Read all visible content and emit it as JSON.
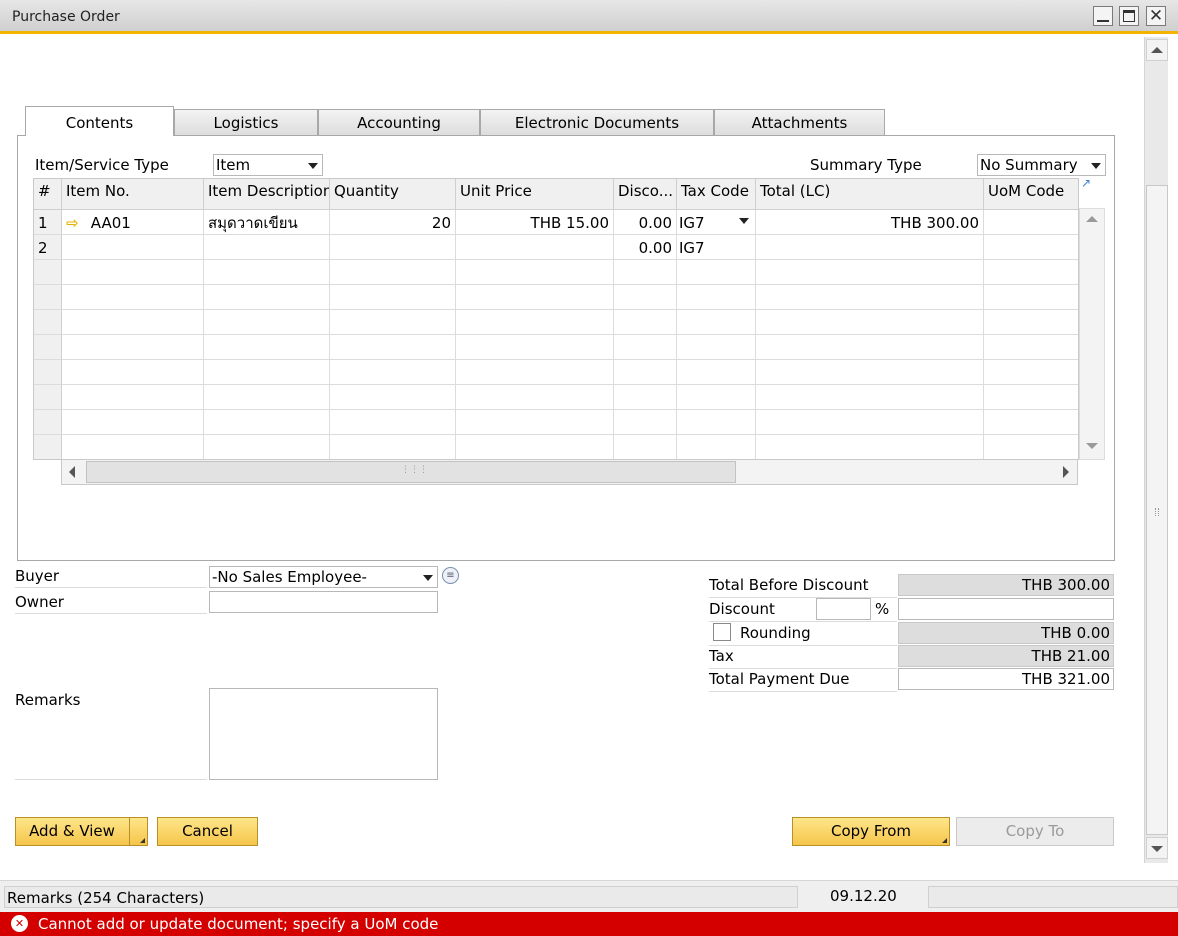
{
  "window": {
    "title": "Purchase Order",
    "min_glyph": "",
    "max_glyph": "",
    "close_glyph": "✕"
  },
  "tabs": [
    {
      "label": "Contents",
      "active": true
    },
    {
      "label": "Logistics"
    },
    {
      "label": "Accounting"
    },
    {
      "label": "Electronic Documents"
    },
    {
      "label": "Attachments"
    }
  ],
  "contents": {
    "item_service_type_label": "Item/Service Type",
    "item_service_type_value": "Item",
    "summary_type_label": "Summary Type",
    "summary_type_value": "No Summary"
  },
  "grid": {
    "columns": [
      "#",
      "Item No.",
      "Item Description",
      "Quantity",
      "Unit Price",
      "Disco...",
      "Tax Code",
      "Total (LC)",
      "UoM Code"
    ],
    "rows": [
      {
        "num": "1",
        "item_no": "AA01",
        "description": "สมุดวาดเขียน",
        "quantity": "20",
        "unit_price": "THB 15.00",
        "discount": "0.00",
        "tax_code": "IG7",
        "total": "THB 300.00",
        "uom": ""
      },
      {
        "num": "2",
        "item_no": "",
        "description": "",
        "quantity": "",
        "unit_price": "",
        "discount": "0.00",
        "tax_code": "IG7",
        "total": "",
        "uom": ""
      }
    ],
    "hscroll_grip": "⋮⋮⋮"
  },
  "buyer": {
    "label": "Buyer",
    "value": "-No Sales Employee-",
    "owner_label": "Owner",
    "owner_value": "",
    "remarks_label": "Remarks",
    "remarks_value": ""
  },
  "totals": {
    "total_before_discount_label": "Total Before Discount",
    "total_before_discount": "THB 300.00",
    "discount_label": "Discount",
    "discount_percent": "",
    "percent_sign": "%",
    "discount_amount": "",
    "rounding_label": "Rounding",
    "rounding_checked": false,
    "rounding": "THB 0.00",
    "tax_label": "Tax",
    "tax": "THB 21.00",
    "total_payment_due_label": "Total Payment Due",
    "total_payment_due": "THB 321.00"
  },
  "buttons": {
    "add_view": "Add & View",
    "cancel": "Cancel",
    "copy_from": "Copy From",
    "copy_to": "Copy To"
  },
  "status": {
    "remarks_hint": "Remarks (254 Characters)",
    "date": "09.12.20",
    "error_message": "Cannot add or update document; specify a UoM code",
    "error_icon_glyph": "✕"
  },
  "colors": {
    "accent": "#f2b400",
    "button": "#f5c54a",
    "error": "#d40000"
  }
}
